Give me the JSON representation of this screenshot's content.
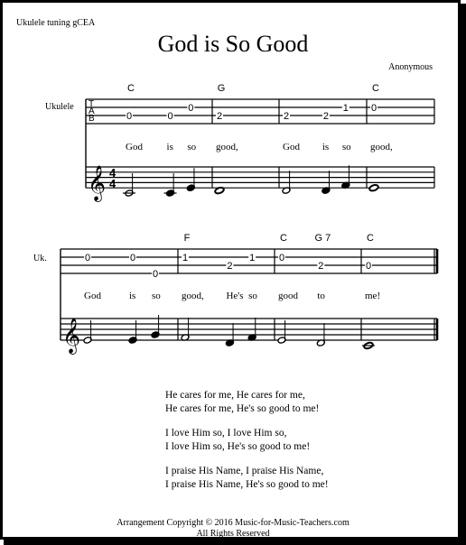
{
  "header": {
    "tuning": "Ukulele tuning gCEA",
    "title": "God is So Good",
    "composer": "Anonymous"
  },
  "systems": [
    {
      "instrument_label": "Ukulele",
      "tab_clef": [
        "T",
        "A",
        "B"
      ],
      "time_signature": [
        "4",
        "4"
      ],
      "chords": [
        {
          "measure": 0,
          "beat": 0,
          "label": "C"
        },
        {
          "measure": 1,
          "beat": 0,
          "label": "G"
        },
        {
          "measure": 3,
          "beat": 0,
          "label": "C"
        }
      ],
      "measures": [
        {
          "tab": [
            {
              "beat": 0,
              "string": 3,
              "fret": "0"
            },
            {
              "beat": 2,
              "string": 3,
              "fret": "0"
            },
            {
              "beat": 3,
              "string": 2,
              "fret": "0"
            }
          ],
          "notes": [
            {
              "beat": 0,
              "pitch": "C4",
              "dur": "half"
            },
            {
              "beat": 2,
              "pitch": "C4",
              "dur": "quarter"
            },
            {
              "beat": 3,
              "pitch": "E4",
              "dur": "quarter"
            }
          ],
          "lyrics": [
            {
              "beat": 0,
              "text": "God"
            },
            {
              "beat": 2,
              "text": "is"
            },
            {
              "beat": 3,
              "text": "so"
            }
          ]
        },
        {
          "tab": [
            {
              "beat": 0,
              "string": 3,
              "fret": "2"
            }
          ],
          "notes": [
            {
              "beat": 0,
              "pitch": "D4",
              "dur": "whole"
            }
          ],
          "lyrics": [
            {
              "beat": 0,
              "text": "good,"
            }
          ]
        },
        {
          "tab": [
            {
              "beat": 0,
              "string": 3,
              "fret": "2"
            },
            {
              "beat": 2,
              "string": 3,
              "fret": "2"
            },
            {
              "beat": 3,
              "string": 2,
              "fret": "1"
            }
          ],
          "notes": [
            {
              "beat": 0,
              "pitch": "D4",
              "dur": "half"
            },
            {
              "beat": 2,
              "pitch": "D4",
              "dur": "quarter"
            },
            {
              "beat": 3,
              "pitch": "F4",
              "dur": "quarter"
            }
          ],
          "lyrics": [
            {
              "beat": 0,
              "text": "God"
            },
            {
              "beat": 2,
              "text": "is"
            },
            {
              "beat": 3,
              "text": "so"
            }
          ]
        },
        {
          "tab": [
            {
              "beat": 0,
              "string": 2,
              "fret": "0"
            }
          ],
          "notes": [
            {
              "beat": 0,
              "pitch": "E4",
              "dur": "whole"
            }
          ],
          "lyrics": [
            {
              "beat": 0,
              "text": "good,"
            }
          ]
        }
      ]
    },
    {
      "instrument_label": "Uk.",
      "chords": [
        {
          "measure": 1,
          "beat": 0,
          "label": "F"
        },
        {
          "measure": 2,
          "beat": 0,
          "label": "C"
        },
        {
          "measure": 2,
          "beat": 2,
          "label": "G 7"
        },
        {
          "measure": 3,
          "beat": 0,
          "label": "C"
        }
      ],
      "measures": [
        {
          "tab": [
            {
              "beat": 0,
              "string": 2,
              "fret": "0"
            },
            {
              "beat": 2,
              "string": 2,
              "fret": "0"
            },
            {
              "beat": 3,
              "string": 4,
              "fret": "0"
            }
          ],
          "notes": [
            {
              "beat": 0,
              "pitch": "E4",
              "dur": "half"
            },
            {
              "beat": 2,
              "pitch": "E4",
              "dur": "quarter"
            },
            {
              "beat": 3,
              "pitch": "G4",
              "dur": "quarter"
            }
          ],
          "lyrics": [
            {
              "beat": 0,
              "text": "God"
            },
            {
              "beat": 2,
              "text": "is"
            },
            {
              "beat": 3,
              "text": "so"
            }
          ]
        },
        {
          "tab": [
            {
              "beat": 0,
              "string": 2,
              "fret": "1"
            },
            {
              "beat": 2,
              "string": 3,
              "fret": "2"
            },
            {
              "beat": 3,
              "string": 2,
              "fret": "1"
            }
          ],
          "notes": [
            {
              "beat": 0,
              "pitch": "F4",
              "dur": "half"
            },
            {
              "beat": 2,
              "pitch": "D4",
              "dur": "quarter"
            },
            {
              "beat": 3,
              "pitch": "F4",
              "dur": "quarter"
            }
          ],
          "lyrics": [
            {
              "beat": 0,
              "text": "good,"
            },
            {
              "beat": 2,
              "text": "He's"
            },
            {
              "beat": 3,
              "text": "so"
            }
          ]
        },
        {
          "tab": [
            {
              "beat": 0,
              "string": 2,
              "fret": "0"
            },
            {
              "beat": 2,
              "string": 3,
              "fret": "2"
            }
          ],
          "notes": [
            {
              "beat": 0,
              "pitch": "E4",
              "dur": "half"
            },
            {
              "beat": 2,
              "pitch": "D4",
              "dur": "half"
            }
          ],
          "lyrics": [
            {
              "beat": 0,
              "text": "good"
            },
            {
              "beat": 2,
              "text": "to"
            }
          ]
        },
        {
          "tab": [
            {
              "beat": 0,
              "string": 3,
              "fret": "0"
            }
          ],
          "notes": [
            {
              "beat": 0,
              "pitch": "C4",
              "dur": "whole"
            }
          ],
          "lyrics": [
            {
              "beat": 0,
              "text": "me!"
            }
          ]
        }
      ]
    }
  ],
  "verses": [
    [
      "He cares for me, He cares for me,",
      "He cares for me, He's so good to me!"
    ],
    [
      "I love Him so, I love Him so,",
      "I love Him so, He's so good to me!"
    ],
    [
      "I praise His Name, I praise His Name,",
      "I praise His Name, He's so good to me!"
    ]
  ],
  "footer": {
    "copyright": "Arrangement Copyright © 2016 Music-for-Music-Teachers.com",
    "rights": "All Rights Reserved"
  }
}
